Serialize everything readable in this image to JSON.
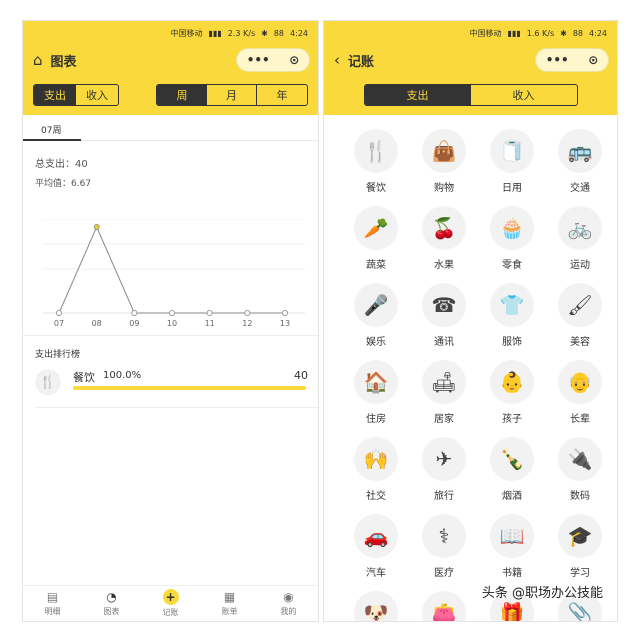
{
  "status": {
    "carrier": "中国移动",
    "speed_left": "2.3 K/s",
    "speed_right": "1.6 K/s",
    "battery": "88",
    "time": "4:24"
  },
  "capsule": {
    "more": "•••",
    "close": "⊙"
  },
  "left": {
    "title": "图表",
    "type_tabs": [
      "支出",
      "收入"
    ],
    "period_tabs": [
      "周",
      "月",
      "年"
    ],
    "week_tab": "07周",
    "total_label": "总支出：",
    "total_value": "40",
    "avg_label": "平均值：",
    "avg_value": "6.67",
    "rank_title": "支出排行榜",
    "rank_item": {
      "name": "餐饮",
      "percent": "100.0%",
      "amount": "40",
      "fraction": 1.0
    },
    "nav": [
      "明细",
      "图表",
      "记账",
      "账单",
      "我的"
    ]
  },
  "chart_data": {
    "type": "line",
    "categories": [
      "07",
      "08",
      "09",
      "10",
      "11",
      "12",
      "13"
    ],
    "values": [
      0,
      40,
      0,
      0,
      0,
      0,
      0
    ],
    "title": "",
    "xlabel": "",
    "ylabel": "",
    "ylim": [
      0,
      40
    ],
    "grid": true,
    "highlight_index": 1,
    "colors": {
      "line": "#888888",
      "highlight": "#f2d12c"
    }
  },
  "right": {
    "title": "记账",
    "type_tabs": [
      "支出",
      "收入"
    ],
    "categories": [
      {
        "label": "餐饮",
        "glyph": "🍴",
        "icon": "fork-knife-icon"
      },
      {
        "label": "购物",
        "glyph": "👜",
        "icon": "bag-icon"
      },
      {
        "label": "日用",
        "glyph": "🧻",
        "icon": "tissue-roll-icon"
      },
      {
        "label": "交通",
        "glyph": "🚌",
        "icon": "bus-icon"
      },
      {
        "label": "蔬菜",
        "glyph": "🥕",
        "icon": "carrot-icon"
      },
      {
        "label": "水果",
        "glyph": "🍒",
        "icon": "cherry-icon"
      },
      {
        "label": "零食",
        "glyph": "🧁",
        "icon": "cupcake-icon"
      },
      {
        "label": "运动",
        "glyph": "🚲",
        "icon": "bicycle-icon"
      },
      {
        "label": "娱乐",
        "glyph": "🎤",
        "icon": "microphone-icon"
      },
      {
        "label": "通讯",
        "glyph": "☎",
        "icon": "phone-icon"
      },
      {
        "label": "服饰",
        "glyph": "👕",
        "icon": "tshirt-icon"
      },
      {
        "label": "美容",
        "glyph": "🖌",
        "icon": "brush-icon"
      },
      {
        "label": "住房",
        "glyph": "🏠",
        "icon": "house-icon"
      },
      {
        "label": "居家",
        "glyph": "🛋",
        "icon": "sofa-icon"
      },
      {
        "label": "孩子",
        "glyph": "👶",
        "icon": "baby-icon"
      },
      {
        "label": "长辈",
        "glyph": "👴",
        "icon": "elder-icon"
      },
      {
        "label": "社交",
        "glyph": "🙌",
        "icon": "social-icon"
      },
      {
        "label": "旅行",
        "glyph": "✈",
        "icon": "airplane-icon"
      },
      {
        "label": "烟酒",
        "glyph": "🍾",
        "icon": "bottle-icon"
      },
      {
        "label": "数码",
        "glyph": "🔌",
        "icon": "plug-icon"
      },
      {
        "label": "汽车",
        "glyph": "🚗",
        "icon": "car-icon"
      },
      {
        "label": "医疗",
        "glyph": "⚕",
        "icon": "medical-kit-icon"
      },
      {
        "label": "书籍",
        "glyph": "📖",
        "icon": "book-icon"
      },
      {
        "label": "学习",
        "glyph": "🎓",
        "icon": "graduation-cap-icon"
      },
      {
        "label": "",
        "glyph": "🐶",
        "icon": "dog-icon"
      },
      {
        "label": "",
        "glyph": "👛",
        "icon": "wallet-icon"
      },
      {
        "label": "",
        "glyph": "🎁",
        "icon": "gift-icon"
      },
      {
        "label": "",
        "glyph": "📎",
        "icon": "clip-icon"
      }
    ]
  },
  "watermark": "头条 @职场办公技能",
  "colors": {
    "brand_yellow": "#fad93c",
    "dark": "#333333"
  }
}
